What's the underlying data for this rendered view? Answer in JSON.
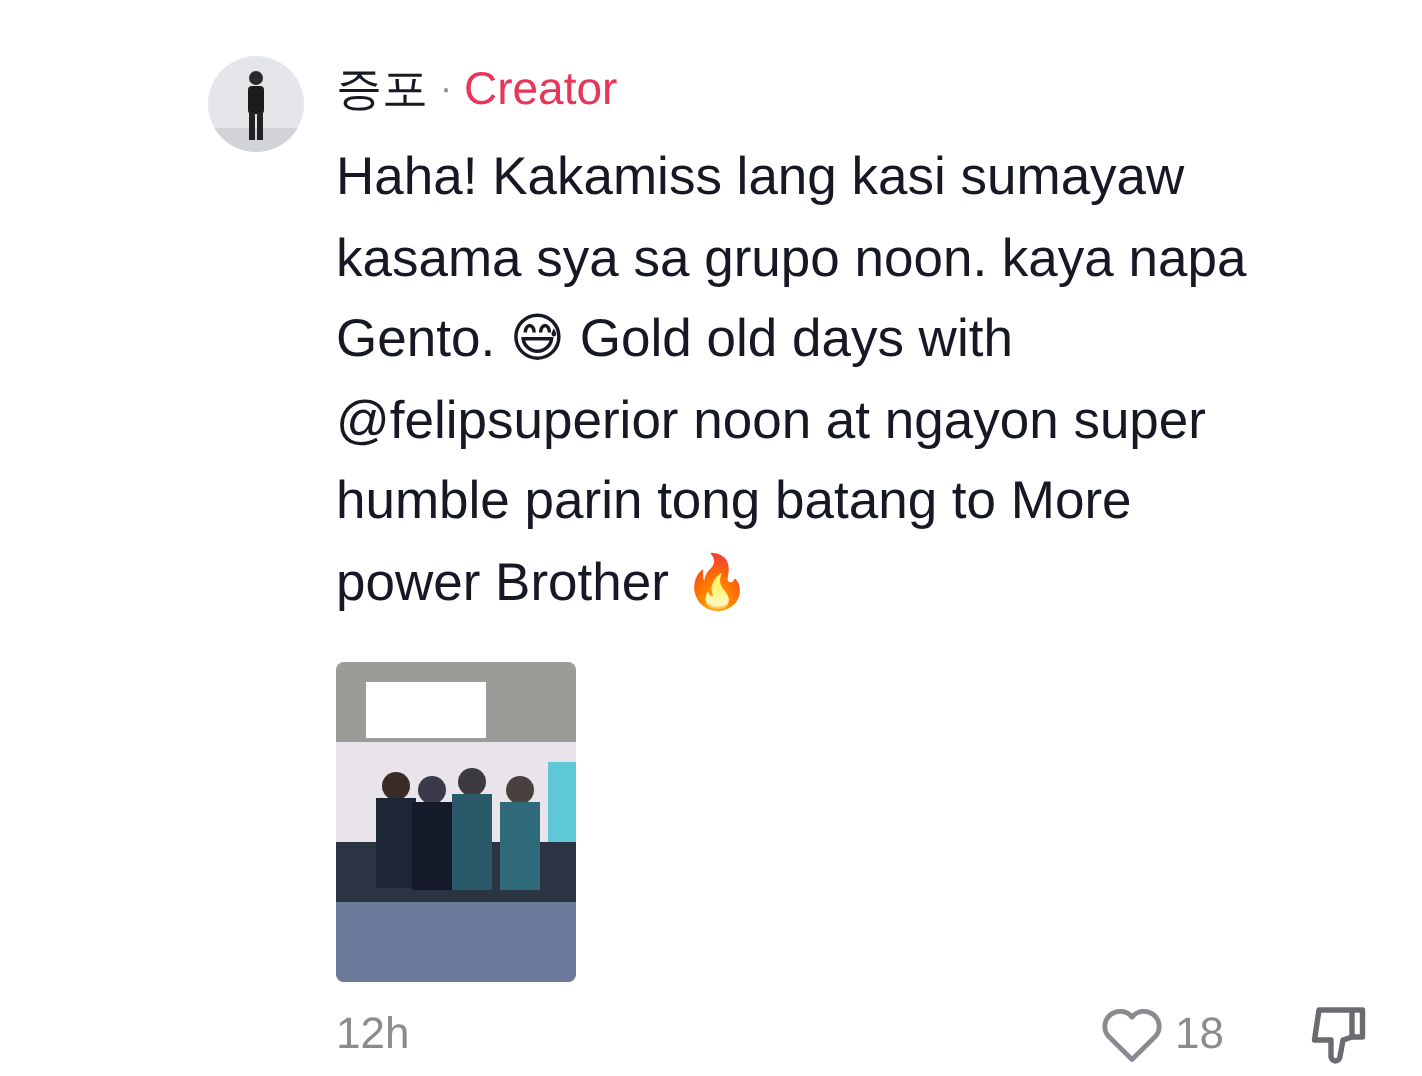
{
  "comment": {
    "author": "증포",
    "separator": "·",
    "badge": "Creator",
    "body": "Haha! Kakamiss lang kasi sumayaw\nkasama sya sa grupo noon. kaya napa\nGento. 😅 Gold old days with\n@felipsuperior noon at ngayon super\nhumble parin tong batang to More\npower Brother 🔥",
    "time": "12h",
    "likes": "18",
    "liked": false
  }
}
